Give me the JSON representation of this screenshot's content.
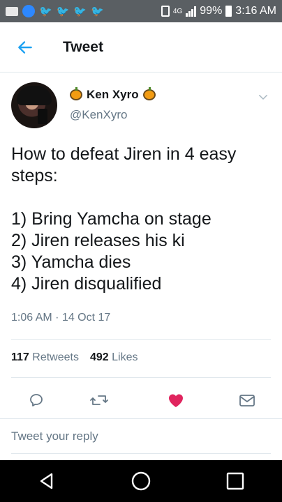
{
  "status_bar": {
    "battery": "99%",
    "time": "3:16 AM",
    "network": "4G",
    "icons": [
      "message-icon",
      "facebook-icon",
      "twitter-bird-icon",
      "twitter-bird-icon",
      "twitter-bird-icon",
      "twitter-bird-icon",
      "vibrate-icon",
      "signal-icon",
      "battery-icon"
    ]
  },
  "header": {
    "title": "Tweet",
    "back_icon": "back-arrow-icon"
  },
  "tweet": {
    "display_name": "Ken Xyro",
    "handle": "@KenXyro",
    "lines": [
      "How to defeat Jiren in 4 easy",
      "steps:",
      "",
      "1) Bring Yamcha on stage",
      "2) Jiren releases his ki",
      "3) Yamcha dies",
      "4) Jiren disqualified"
    ],
    "timestamp": "1:06 AM · 14 Oct 17",
    "retweets_count": "117",
    "retweets_label": "Retweets",
    "likes_count": "492",
    "likes_label": "Likes"
  },
  "actions": {
    "icons": [
      "reply-icon",
      "retweet-icon",
      "like-icon",
      "direct-message-icon"
    ],
    "like_color": "#e0245e",
    "icon_color": "#657786"
  },
  "reply": {
    "placeholder": "Tweet your reply"
  },
  "colors": {
    "accent": "#1da1f2",
    "text": "#14171a",
    "muted": "#657786"
  }
}
